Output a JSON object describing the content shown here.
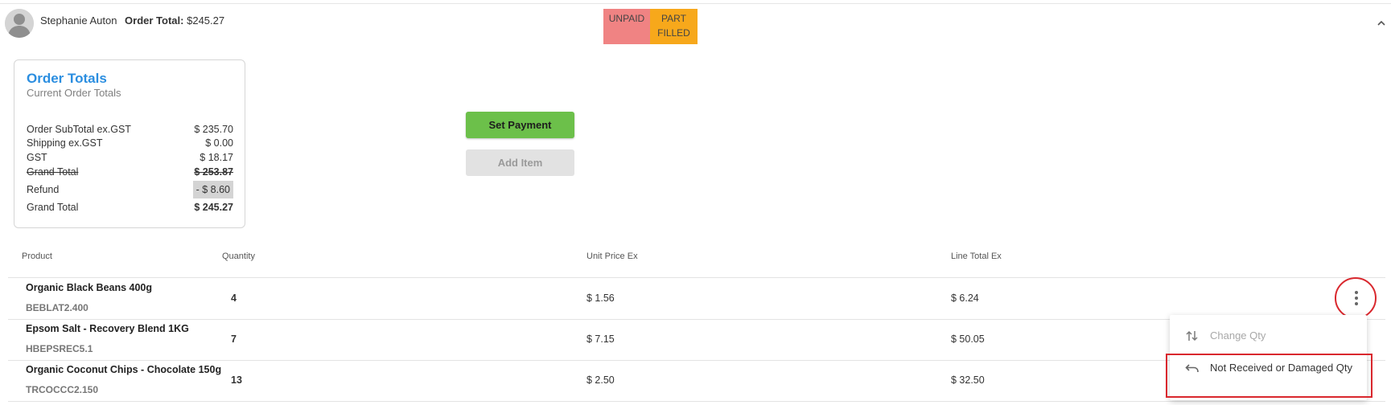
{
  "header": {
    "customer_name": "Stephanie Auton",
    "order_total_label": "Order Total:",
    "order_total_value": "$245.27",
    "badges": {
      "payment_status": "UNPAID",
      "fulfillment_line1": "PART",
      "fulfillment_line2": "FILLED",
      "payment_color": "#f08383",
      "fulfillment_color": "#f7a81b"
    },
    "collapse_icon": "chevron-up-icon"
  },
  "totals_card": {
    "title": "Order Totals",
    "subtitle": "Current Order Totals",
    "rows": [
      {
        "label": "Order SubTotal ex.GST",
        "value": "$ 235.70"
      },
      {
        "label": "Shipping ex.GST",
        "value": "$ 0.00"
      },
      {
        "label": "GST",
        "value": "$ 18.17"
      },
      {
        "label": "Grand Total",
        "value": "$ 253.87"
      },
      {
        "label": "Refund",
        "value": "- $ 8.60"
      },
      {
        "label": "Grand Total",
        "value": "$ 245.27"
      }
    ]
  },
  "actions": {
    "set_payment_label": "Set Payment",
    "add_item_label": "Add Item"
  },
  "table": {
    "columns": [
      "Product",
      "Quantity",
      "Unit Price Ex",
      "Line Total Ex"
    ],
    "rows": [
      {
        "name": "Organic Black Beans 400g",
        "sku": "BEBLAT2.400",
        "qty": "4",
        "unit_price": "$ 1.56",
        "line_total": "$ 6.24"
      },
      {
        "name": "Epsom Salt - Recovery Blend 1KG",
        "sku": "HBEPSREC5.1",
        "qty": "7",
        "unit_price": "$ 7.15",
        "line_total": "$ 50.05"
      },
      {
        "name": "Organic Coconut Chips - Chocolate 150g",
        "sku": "TRCOCCC2.150",
        "qty": "13",
        "unit_price": "$ 2.50",
        "line_total": "$ 32.50"
      }
    ]
  },
  "context_menu": {
    "items": [
      {
        "label": "Change Qty",
        "icon": "swap-vertical-icon",
        "disabled": true
      },
      {
        "label": "Not Received or Damaged Qty",
        "icon": "undo-icon",
        "disabled": false
      }
    ]
  },
  "colors": {
    "accent_blue": "#2b8ee0",
    "button_green": "#6cc04a",
    "highlight_red": "#d9282e"
  }
}
